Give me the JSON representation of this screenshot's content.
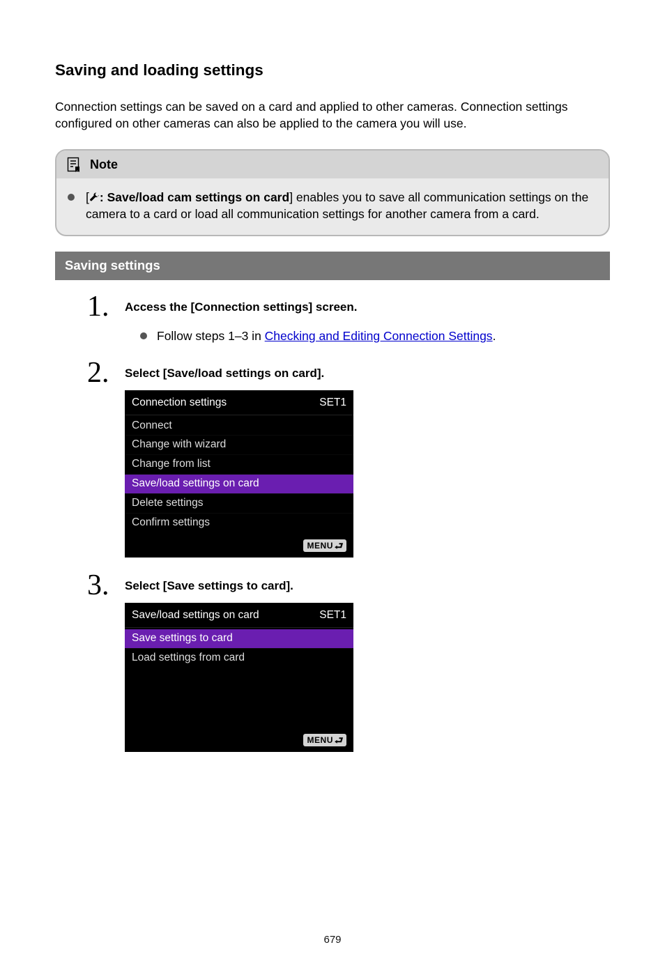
{
  "title": "Saving and loading settings",
  "intro": "Connection settings can be saved on a card and applied to other cameras. Connection settings configured on other cameras can also be applied to the camera you will use.",
  "note": {
    "label": "Note",
    "prefix": "[",
    "bold": ": Save/load cam settings on card",
    "suffix": "] enables you to save all communication settings on the camera to a card or load all communication settings for another camera from a card."
  },
  "section_label": "Saving settings",
  "steps": [
    {
      "title": "Access the [Connection settings] screen.",
      "sub": {
        "pre": "Follow steps 1–3 in ",
        "link": "Checking and Editing Connection Settings",
        "post": "."
      }
    },
    {
      "title": "Select [Save/load settings on card].",
      "screen": {
        "header_left": "Connection settings",
        "header_right": "SET1",
        "items": [
          {
            "label": "Connect",
            "selected": false
          },
          {
            "label": "Change with wizard",
            "selected": false
          },
          {
            "label": "Change from list",
            "selected": false
          },
          {
            "label": "Save/load settings on card",
            "selected": true
          },
          {
            "label": "Delete settings",
            "selected": false
          },
          {
            "label": "Confirm settings",
            "selected": false
          }
        ],
        "menu_label": "MENU"
      }
    },
    {
      "title": "Select [Save settings to card].",
      "screen": {
        "header_left": "Save/load settings on card",
        "header_right": "SET1",
        "items": [
          {
            "label": "Save settings to card",
            "selected": true
          },
          {
            "label": "Load settings from card",
            "selected": false
          }
        ],
        "spacer": true,
        "menu_label": "MENU"
      }
    }
  ],
  "page_number": "679"
}
